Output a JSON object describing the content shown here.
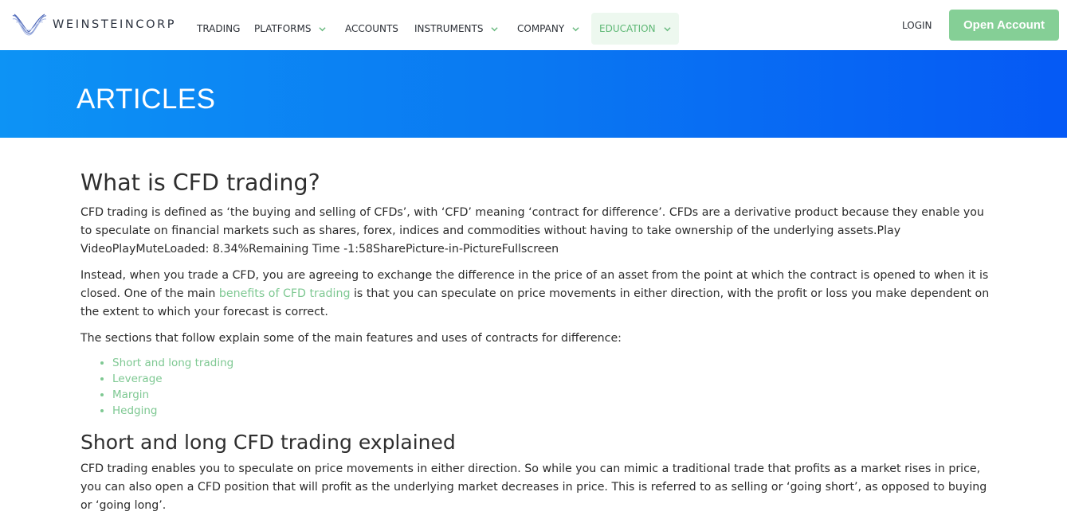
{
  "brand": {
    "name": "WEINSTEINCORP",
    "accent_color": "#85cf96",
    "link_color": "#7ec892",
    "hero_gradient": [
      "#0d93f5",
      "#0559f5"
    ]
  },
  "nav": {
    "items": [
      {
        "label": "TRADING",
        "has_dropdown": false
      },
      {
        "label": "PLATFORMS",
        "has_dropdown": true
      },
      {
        "label": "ACCOUNTS",
        "has_dropdown": false
      },
      {
        "label": "INSTRUMENTS",
        "has_dropdown": true
      },
      {
        "label": "COMPANY",
        "has_dropdown": true
      },
      {
        "label": "EDUCATION",
        "has_dropdown": true,
        "active": true
      }
    ],
    "login_label": "LOGIN",
    "open_account_label": "Open Account"
  },
  "hero": {
    "title": "ARTICLES"
  },
  "article": {
    "title": "What is CFD trading?",
    "p1": "CFD trading is defined as ‘the buying and selling of CFDs’, with ‘CFD’ meaning ‘contract for difference’. CFDs are a derivative product because they enable you to speculate on financial markets such as shares, forex, indices and commodities without having to take ownership of the underlying assets.Play VideoPlayMuteLoaded: 8.34%Remaining Time -1:58SharePicture-in-PictureFullscreen",
    "p2_before": "Instead, when you trade a CFD, you are agreeing to exchange the difference in the price of an asset from the point at which the contract is opened to when it is closed. One of the main ",
    "p2_link": "benefits of CFD trading",
    "p2_after": " is that you can speculate on price movements in either direction, with the profit or loss you make dependent on the extent to which your forecast is correct.",
    "p3": "The sections that follow explain some of the main features and uses of contracts for difference:",
    "toc": [
      "Short and long trading",
      "Leverage",
      "Margin",
      "Hedging"
    ],
    "section2_title": "Short and long CFD trading explained",
    "p4": "CFD trading enables you to speculate on price movements in either direction. So while you can mimic a traditional trade that profits as a market rises in price, you can also open a CFD position that will profit as the underlying market decreases in price. This is referred to as selling or ‘going short’, as opposed to buying or ‘going long’."
  }
}
